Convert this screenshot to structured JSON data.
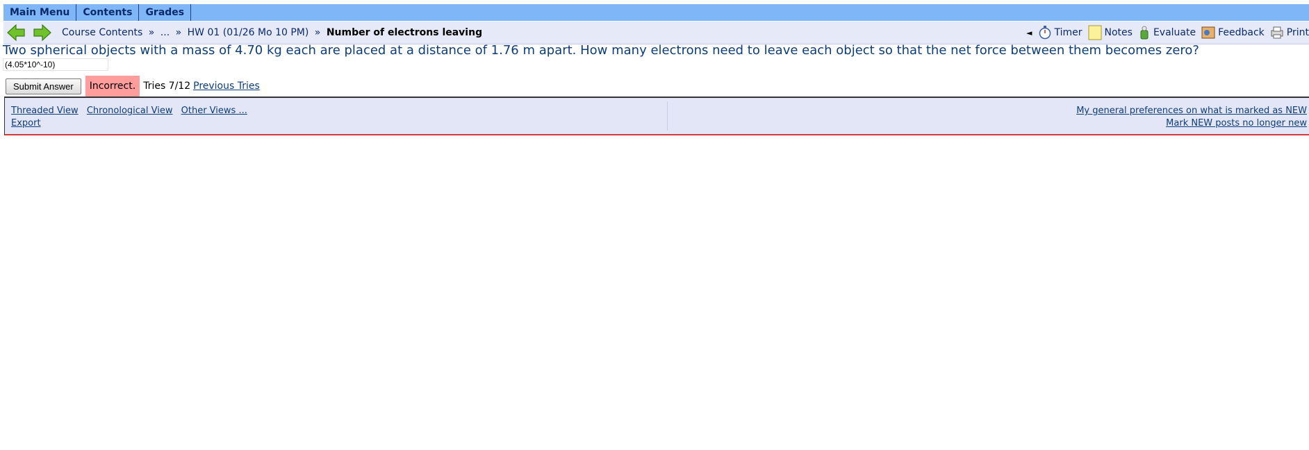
{
  "menu": {
    "items": [
      "Main Menu",
      "Contents",
      "Grades"
    ]
  },
  "nav": {
    "back_icon": "left-arrow-icon",
    "forward_icon": "right-arrow-icon",
    "breadcrumb": {
      "course_contents": "Course Contents",
      "sep": "»",
      "ellipsis": "...",
      "hw": "HW 01 (01/26 Mo 10 PM)",
      "current": "Number of electrons leaving"
    },
    "tools": {
      "collapse": "◄",
      "timer": "Timer",
      "notes": "Notes",
      "evaluate": "Evaluate",
      "feedback": "Feedback",
      "print": "Print"
    }
  },
  "problem": {
    "question": "Two spherical objects with a mass of 4.70 kg each are placed at a distance of 1.76 m apart. How many electrons need to leave each object so that the net force between them becomes zero?",
    "answer_value": "(4.05*10^-10)",
    "submit_label": "Submit Answer",
    "status": "Incorrect.",
    "tries": "Tries 7/12",
    "previous_tries": "Previous Tries"
  },
  "discussion": {
    "threaded": "Threaded View",
    "chronological": "Chronological View",
    "other": " Other Views ...",
    "export": "Export",
    "prefs": "My general preferences on what is marked as NEW",
    "mark_new": "Mark NEW posts no longer new"
  },
  "colors": {
    "menu_bg": "#7fb6f7",
    "nav_bg": "#e6e9f7",
    "incorrect_bg": "#ff9c9c",
    "link": "#0d3d7a"
  }
}
